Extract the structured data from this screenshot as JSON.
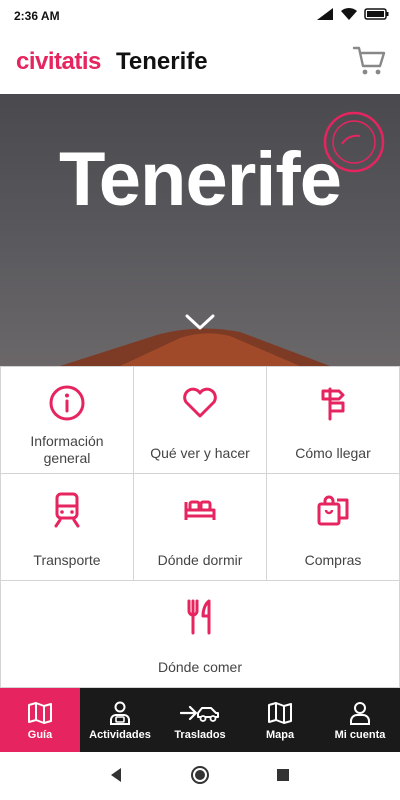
{
  "status_bar": {
    "time": "2:36 AM"
  },
  "header": {
    "brand": "civitatis",
    "city": "Tenerife"
  },
  "hero": {
    "title": "Tenerife"
  },
  "grid": {
    "items": [
      {
        "label": "Información general",
        "icon": "info-icon"
      },
      {
        "label": "Qué ver y hacer",
        "icon": "heart-icon"
      },
      {
        "label": "Cómo llegar",
        "icon": "signpost-icon"
      },
      {
        "label": "Transporte",
        "icon": "train-icon"
      },
      {
        "label": "Dónde dormir",
        "icon": "bed-icon"
      },
      {
        "label": "Compras",
        "icon": "shopping-bag-icon"
      },
      {
        "label": "Dónde comer",
        "icon": "fork-knife-icon"
      }
    ]
  },
  "bottom_nav": {
    "items": [
      {
        "label": "Guía",
        "icon": "map-book-icon",
        "active": true
      },
      {
        "label": "Actividades",
        "icon": "person-icon"
      },
      {
        "label": "Traslados",
        "icon": "car-arrow-icon"
      },
      {
        "label": "Mapa",
        "icon": "map-icon"
      },
      {
        "label": "Mi cuenta",
        "icon": "user-icon"
      }
    ]
  },
  "colors": {
    "accent": "#e6245f",
    "nav_bg": "#1a1a1a",
    "text": "#444444"
  }
}
